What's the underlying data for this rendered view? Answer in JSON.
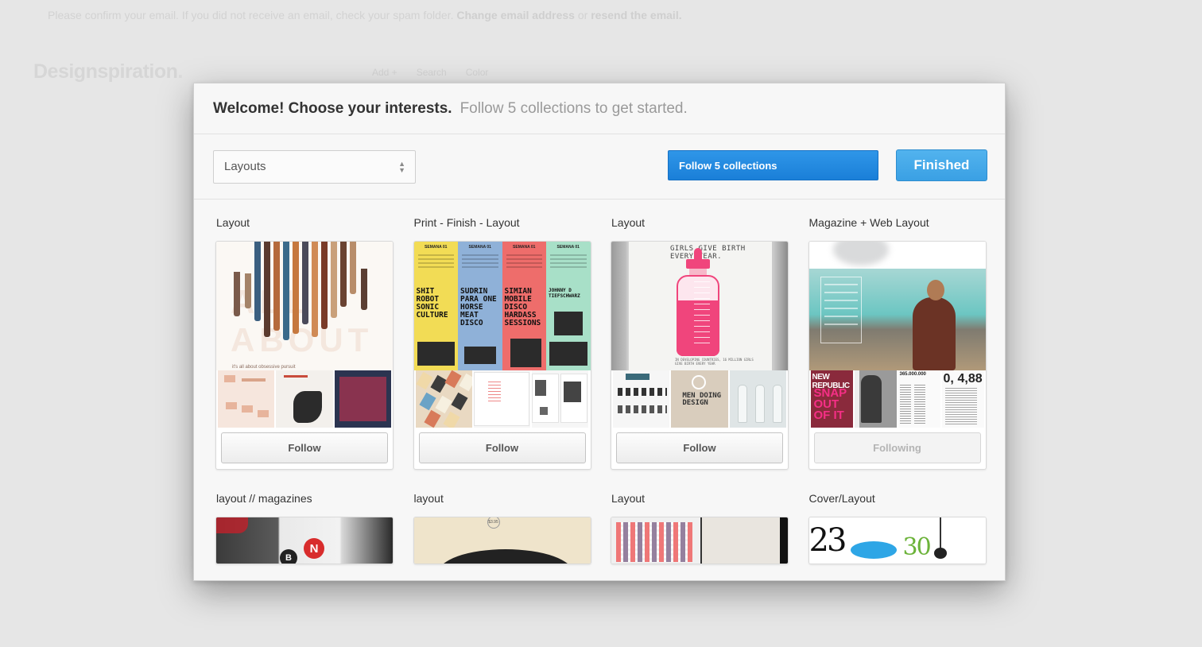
{
  "background": {
    "banner_prefix": "Please confirm your email. If you did not receive an email, check your spam folder.",
    "banner_change": "Change email address",
    "banner_or": "or",
    "banner_resend": "resend the email.",
    "logo": "Designspiration",
    "logo_dot": ".",
    "nav": [
      "Add +",
      "Search",
      "Color"
    ]
  },
  "modal": {
    "title": "Welcome! Choose your interests.",
    "subtitle": "Follow 5 collections to get started.",
    "select_value": "Layouts",
    "follow_all_label": "Follow 5 collections",
    "finished_label": "Finished"
  },
  "collections": [
    {
      "title": "Layout",
      "button": "Follow",
      "following": false
    },
    {
      "title": "Print - Finish - Layout",
      "button": "Follow",
      "following": false
    },
    {
      "title": "Layout",
      "button": "Follow",
      "following": false
    },
    {
      "title": "Magazine + Web Layout",
      "button": "Following",
      "following": true
    },
    {
      "title": "layout // magazines"
    },
    {
      "title": "layout"
    },
    {
      "title": "Layout"
    },
    {
      "title": "Cover/Layout"
    }
  ],
  "image_text": {
    "poster_heads": [
      "SEMANA 01",
      "SEMANA 01",
      "SEMANA 01",
      "SEMANA 01"
    ],
    "poster_big": [
      "SHIT ROBOT SONIC CULTURE",
      "SUDRIN PARA ONE HORSE MEAT DISCO",
      "SIMIAN MOBILE DISCO HARDASS SESSIONS",
      "JOHNNY D TIEFSCHWARZ"
    ],
    "bottle_head": "GIRLS GIVE BIRTH EVERY YEAR.",
    "img1_caption": "it's all about obsessive pursuit",
    "thumb_men": "MEN DOING DESIGN",
    "thumb_republic": "NEW REPUBLIC",
    "thumb_snap": "SNAP OUT OF IT",
    "thumb_num": "365.000.000",
    "thumb_big_a": "0,",
    "thumb_big_b": "4,88",
    "r2_n": "N",
    "r2_b": "B",
    "r2_price": "$3.95",
    "r2_23": "23",
    "r2_30": "30"
  }
}
